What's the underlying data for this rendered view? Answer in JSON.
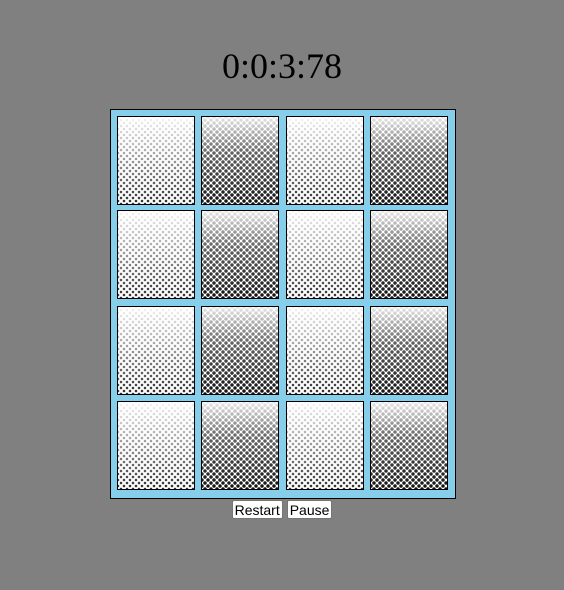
{
  "timer": {
    "text": "0:0:3:78"
  },
  "board": {
    "rows": 4,
    "columns": 4,
    "background_color": "#87CEEB",
    "cards": [
      {
        "pattern": "light",
        "state": "face-down"
      },
      {
        "pattern": "dark",
        "state": "face-down"
      },
      {
        "pattern": "light",
        "state": "face-down"
      },
      {
        "pattern": "dark",
        "state": "face-down"
      },
      {
        "pattern": "light",
        "state": "face-down"
      },
      {
        "pattern": "dark",
        "state": "face-down"
      },
      {
        "pattern": "light",
        "state": "face-down"
      },
      {
        "pattern": "dark",
        "state": "face-down"
      },
      {
        "pattern": "light",
        "state": "face-down"
      },
      {
        "pattern": "dark",
        "state": "face-down"
      },
      {
        "pattern": "light",
        "state": "face-down"
      },
      {
        "pattern": "dark",
        "state": "face-down"
      },
      {
        "pattern": "light",
        "state": "face-down"
      },
      {
        "pattern": "dark",
        "state": "face-down"
      },
      {
        "pattern": "light",
        "state": "face-down"
      },
      {
        "pattern": "dark",
        "state": "face-down"
      }
    ]
  },
  "controls": {
    "restart_label": "Restart",
    "pause_label": "Pause"
  },
  "colors": {
    "page_background": "#808080",
    "board_background": "#87CEEB"
  }
}
